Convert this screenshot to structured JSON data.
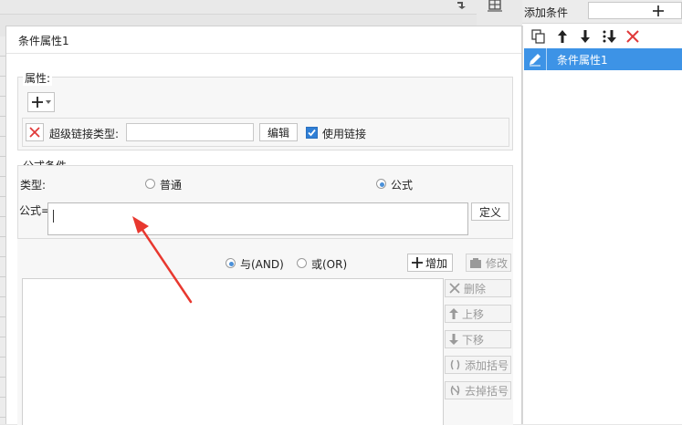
{
  "dialog": {
    "title": "条件属性1"
  },
  "properties": {
    "group_label": "属性:",
    "hyperlink_type_label": "超级链接类型:",
    "hyperlink_type_value": "",
    "edit_button": "编辑",
    "use_link_label": "使用链接",
    "use_link_checked": true
  },
  "formula_condition": {
    "group_label": "公式条件",
    "type_label": "类型:",
    "type_options": [
      "普通",
      "公式"
    ],
    "type_selected": "公式",
    "formula_label": "公式=",
    "formula_value": "",
    "define_button": "定义"
  },
  "logic": {
    "and_label": "与(AND)",
    "or_label": "或(OR)",
    "selected": "与(AND)",
    "add_button": "增加",
    "modify_button": "修改",
    "delete_button": "删除",
    "move_up_button": "上移",
    "move_down_button": "下移",
    "add_bracket_button": "添加括号",
    "remove_bracket_button": "去掉括号"
  },
  "right_panel": {
    "add_condition_label": "添加条件",
    "add_icon": "plus-icon",
    "toolbar_icons": [
      "copy-icon",
      "arrow-up-icon",
      "arrow-down-icon",
      "move-bottom-icon",
      "delete-icon"
    ],
    "list_items": [
      {
        "label": "条件属性1",
        "icon": "pencil-icon",
        "selected": true
      }
    ]
  },
  "colors": {
    "accent": "#3d93e6",
    "delete_red": "#e03a3a",
    "annotation_arrow": "#e8382f"
  }
}
